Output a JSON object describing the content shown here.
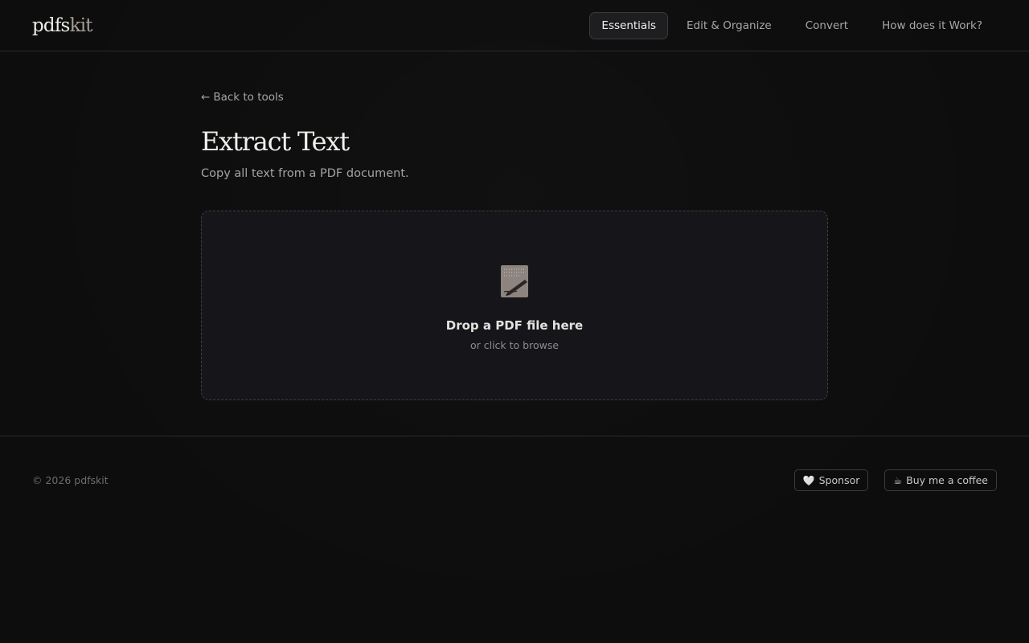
{
  "header": {
    "logo_main": "pdfs",
    "logo_suffix": "kit",
    "nav": [
      {
        "label": "Essentials",
        "active": true
      },
      {
        "label": "Edit & Organize",
        "active": false
      },
      {
        "label": "Convert",
        "active": false
      },
      {
        "label": "How does it Work?",
        "active": false
      }
    ]
  },
  "main": {
    "back_arrow": "←",
    "back_label": "Back to tools",
    "title": "Extract Text",
    "subtitle": "Copy all text from a PDF document.",
    "dropzone": {
      "icon": "file-pen-icon",
      "title": "Drop a PDF file here",
      "subtitle": "or click to browse"
    }
  },
  "footer": {
    "copyright": "© 2026 pdfskit",
    "sponsor_icon": "🤍",
    "sponsor_label": "Sponsor",
    "coffee_icon": "☕",
    "coffee_label": "Buy me a coffee"
  },
  "colors": {
    "background": "#0d0d0d",
    "panel": "#16161a",
    "accent_muted": "#a89e96"
  }
}
